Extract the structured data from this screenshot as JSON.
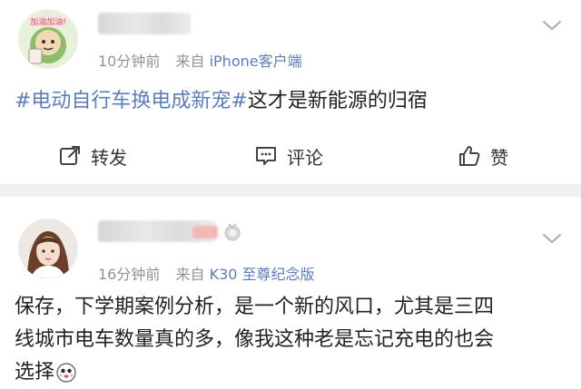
{
  "posts": [
    {
      "avatar_badge": "加油加油!",
      "time": "10分钟前",
      "from_label": "来自",
      "source": "iPhone客户端",
      "hashtag": "#电动自行车换电成新宠#",
      "text": "这才是新能源的归宿",
      "actions": {
        "repost": "转发",
        "comment": "评论",
        "like": "赞"
      }
    },
    {
      "time": "16分钟前",
      "from_label": "来自",
      "source": "K30 至尊纪念版",
      "text_lines": [
        "保存，下学期案例分析，是一个新的风口，尤其是三四",
        "线城市电车数量真的多，像我这种老是忘记充电的也会",
        "选择"
      ]
    }
  ],
  "icons": {
    "repost": "repost-icon",
    "comment": "comment-icon",
    "like": "thumbs-up-icon",
    "more": "chevron-down-icon",
    "emoji": "emoji-icon"
  },
  "colors": {
    "link": "#5b7dbb",
    "meta": "#939393",
    "separator": "#f0f0f0"
  }
}
